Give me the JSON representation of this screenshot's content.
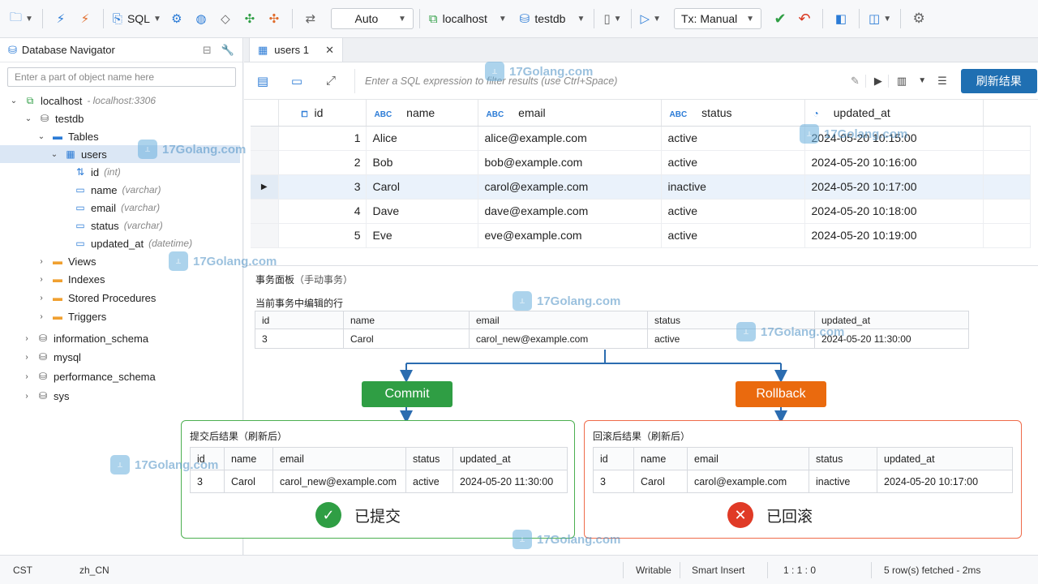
{
  "toolbar": {
    "sql_label": "SQL",
    "commit_mode": "Auto",
    "connection": "localhost",
    "database": "testdb",
    "tx_mode": "Tx: Manual"
  },
  "navigator": {
    "title": "Database Navigator",
    "search_placeholder": "Enter a part of object name here",
    "server": {
      "name": "localhost",
      "detail": "- localhost:3306"
    },
    "db": "testdb",
    "tables_folder": "Tables",
    "table": "users",
    "columns": [
      {
        "name": "id",
        "type": "(int)"
      },
      {
        "name": "name",
        "type": "(varchar)"
      },
      {
        "name": "email",
        "type": "(varchar)"
      },
      {
        "name": "status",
        "type": "(varchar)"
      },
      {
        "name": "updated_at",
        "type": "(datetime)"
      }
    ],
    "folders": [
      "Views",
      "Indexes",
      "Stored Procedures",
      "Triggers"
    ],
    "other_dbs": [
      "information_schema",
      "mysql",
      "performance_schema",
      "sys"
    ]
  },
  "editor": {
    "tab_label": "users 1",
    "filter_placeholder": "Enter a SQL expression to filter results (use Ctrl+Space)",
    "refresh_label": "刷新结果"
  },
  "grid": {
    "columns": [
      "id",
      "name",
      "email",
      "status",
      "updated_at"
    ],
    "rows": [
      {
        "id": "1",
        "name": "Alice",
        "email": "alice@example.com",
        "status": "active",
        "updated_at": "2024-05-20 10:15:00"
      },
      {
        "id": "2",
        "name": "Bob",
        "email": "bob@example.com",
        "status": "active",
        "updated_at": "2024-05-20 10:16:00"
      },
      {
        "id": "3",
        "name": "Carol",
        "email": "carol@example.com",
        "status": "inactive",
        "updated_at": "2024-05-20 10:17:00"
      },
      {
        "id": "4",
        "name": "Dave",
        "email": "dave@example.com",
        "status": "active",
        "updated_at": "2024-05-20 10:18:00"
      },
      {
        "id": "5",
        "name": "Eve",
        "email": "eve@example.com",
        "status": "active",
        "updated_at": "2024-05-20 10:19:00"
      }
    ]
  },
  "tx": {
    "title": "事务面板",
    "title_note": "（手动事务）",
    "edited_title": "当前事务中编辑的行",
    "edited_row": {
      "id": "3",
      "name": "Carol",
      "email": "carol_new@example.com",
      "status": "active",
      "updated_at": "2024-05-20 11:30:00"
    },
    "commit_label": "Commit",
    "rollback_label": "Rollback",
    "commit_result_title": "提交后结果（刷新后）",
    "commit_row": {
      "id": "3",
      "name": "Carol",
      "email": "carol_new@example.com",
      "status": "active",
      "updated_at": "2024-05-20 11:30:00"
    },
    "commit_state": "已提交",
    "rollback_result_title": "回滚后结果（刷新后）",
    "rollback_row": {
      "id": "3",
      "name": "Carol",
      "email": "carol@example.com",
      "status": "inactive",
      "updated_at": "2024-05-20 10:17:00"
    },
    "rollback_state": "已回滚",
    "colors": {
      "commit": "#2f9e44",
      "rollback": "#ea6a0e",
      "changed": "#d9361e"
    }
  },
  "status_bar": {
    "tz": "CST",
    "locale": "zh_CN",
    "mode": "Writable",
    "insert": "Smart Insert",
    "pos": "1 : 1 : 0",
    "fetched": "5 row(s) fetched - 2ms"
  },
  "watermark": "17Golang.com"
}
